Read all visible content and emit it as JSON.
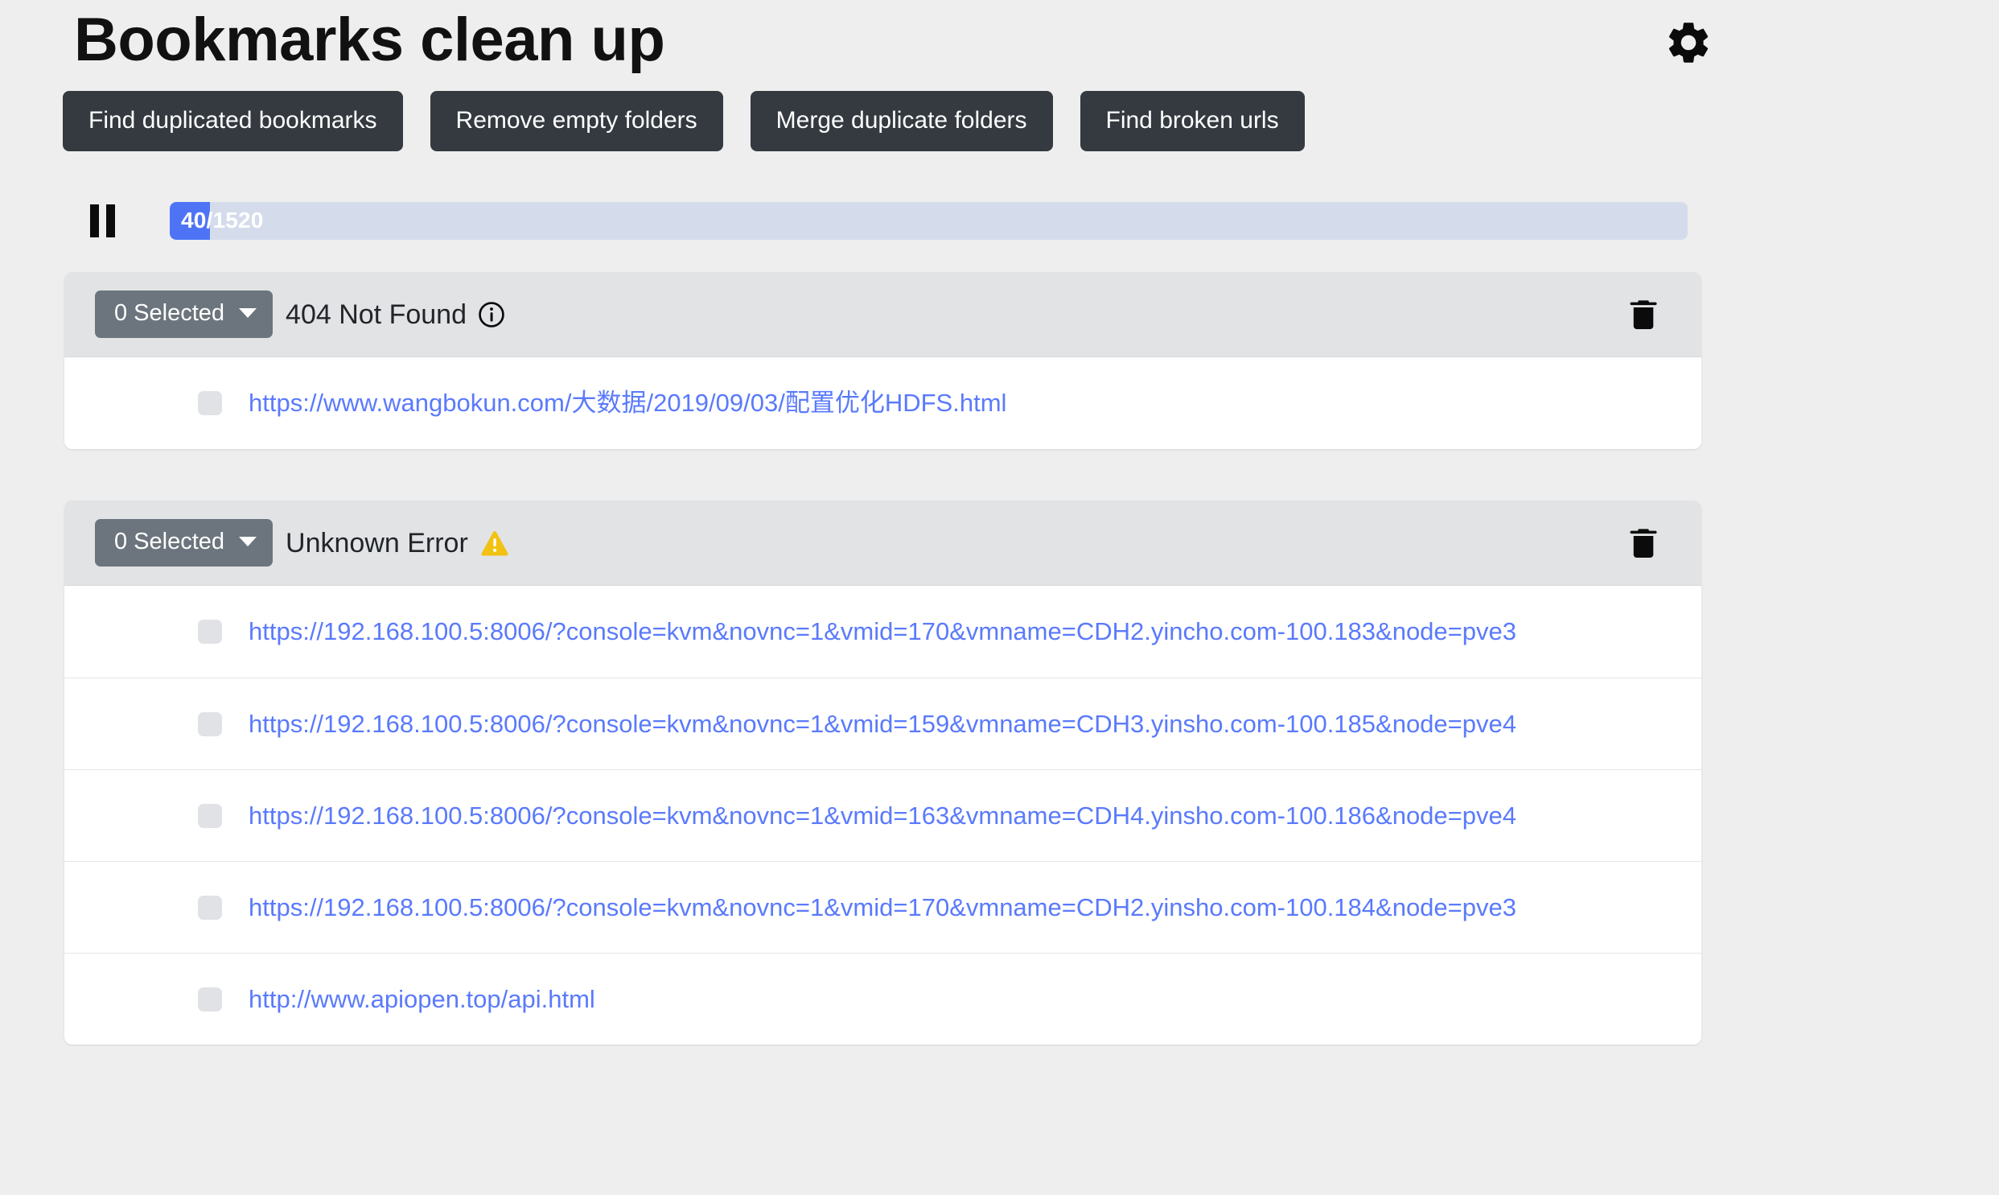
{
  "header": {
    "title": "Bookmarks clean up",
    "settings_icon": "gear-icon"
  },
  "toolbar": {
    "buttons": [
      {
        "label": "Find duplicated bookmarks"
      },
      {
        "label": "Remove empty folders"
      },
      {
        "label": "Merge duplicate folders"
      },
      {
        "label": "Find broken urls"
      }
    ]
  },
  "progress": {
    "pause_icon": "pause-icon",
    "label": "40/1520",
    "current": 40,
    "total": 1520,
    "percent": 2.63,
    "fill_color": "#4e74f5",
    "track_color": "#d4dcec"
  },
  "colors": {
    "page_background": "#eeeeee",
    "button_dark": "#343a40",
    "dropdown_gray": "#6c757d",
    "card_header": "#e2e3e5",
    "link_blue": "#5a7afc",
    "warning_yellow": "#f2c212"
  },
  "cards": [
    {
      "id": "card-404",
      "select_label": "0 Selected",
      "status": "404 Not Found",
      "status_icon": "info-icon",
      "delete_icon": "trash-icon",
      "rows": [
        {
          "url": "https://www.wangbokun.com/大数据/2019/09/03/配置优化HDFS.html"
        }
      ]
    },
    {
      "id": "card-unknown",
      "select_label": "0 Selected",
      "status": "Unknown Error",
      "status_icon": "warning-triangle-icon",
      "delete_icon": "trash-icon",
      "rows": [
        {
          "url": "https://192.168.100.5:8006/?console=kvm&novnc=1&vmid=170&vmname=CDH2.yincho.com-100.183&node=pve3"
        },
        {
          "url": "https://192.168.100.5:8006/?console=kvm&novnc=1&vmid=159&vmname=CDH3.yinsho.com-100.185&node=pve4"
        },
        {
          "url": "https://192.168.100.5:8006/?console=kvm&novnc=1&vmid=163&vmname=CDH4.yinsho.com-100.186&node=pve4"
        },
        {
          "url": "https://192.168.100.5:8006/?console=kvm&novnc=1&vmid=170&vmname=CDH2.yinsho.com-100.184&node=pve3"
        },
        {
          "url": "http://www.apiopen.top/api.html"
        }
      ]
    }
  ]
}
